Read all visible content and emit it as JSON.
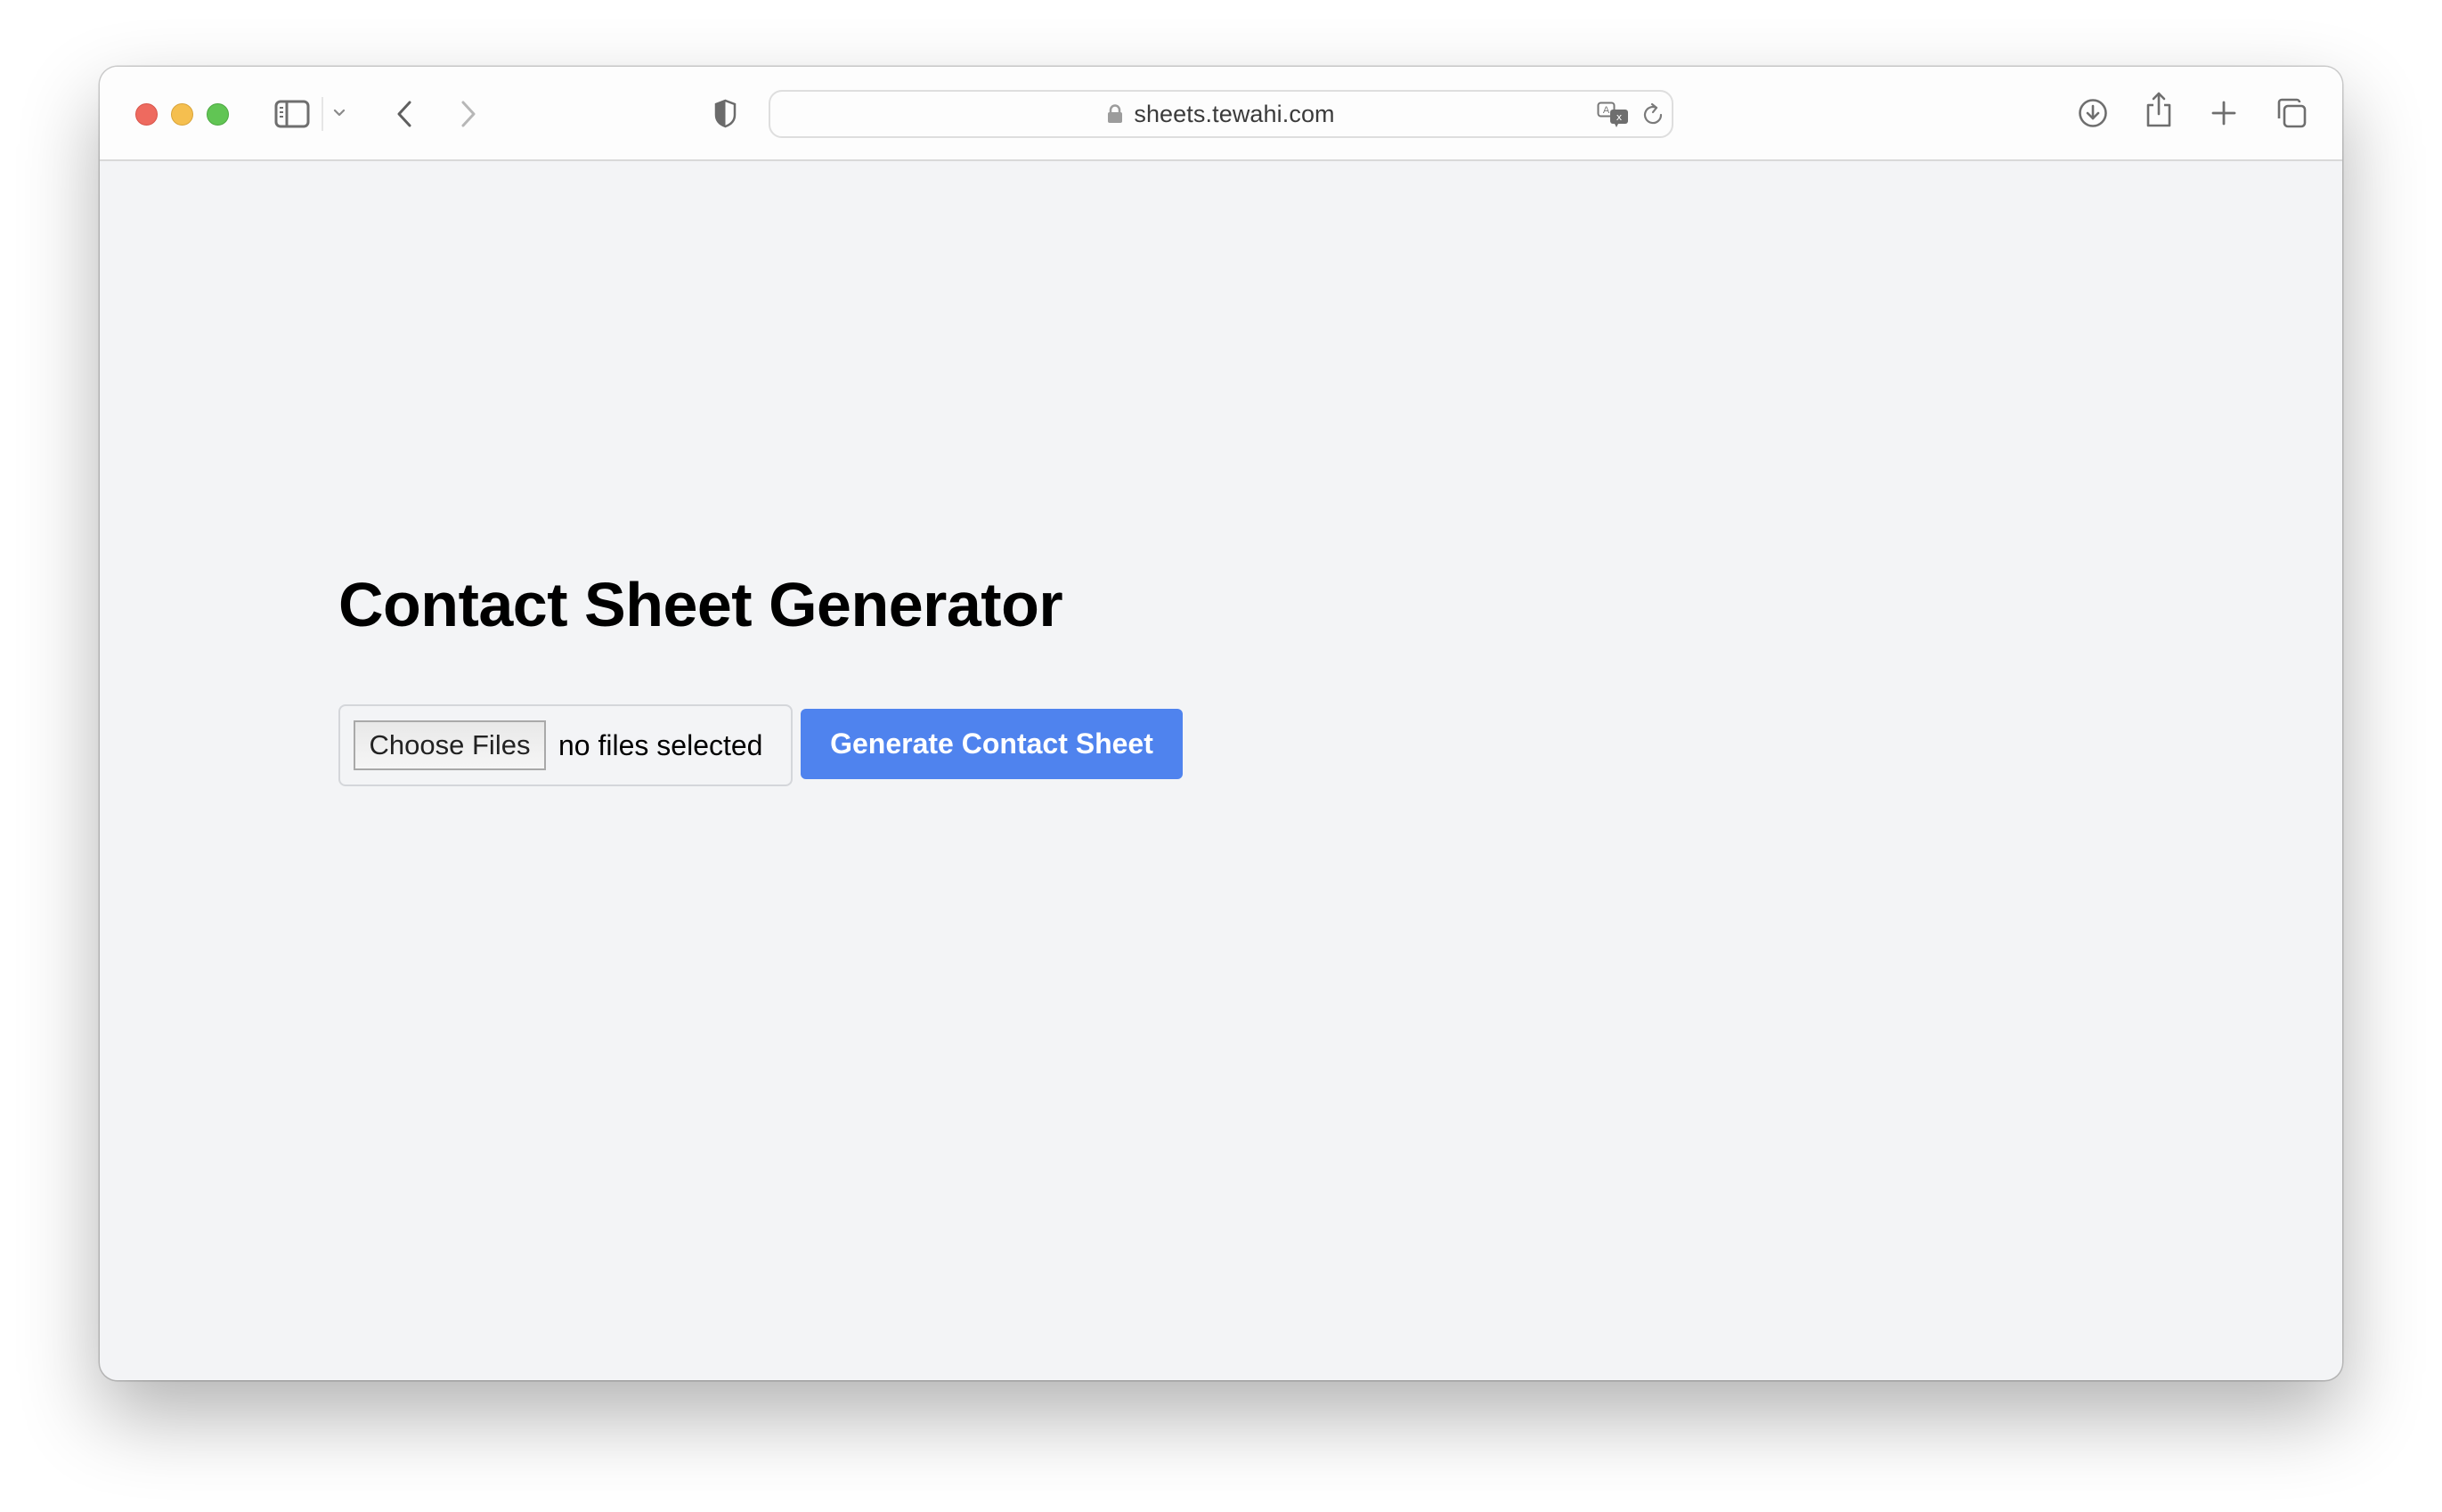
{
  "browser": {
    "url": "sheets.tewahi.com",
    "icons": {
      "sidebar": "sidebar-icon",
      "tab_group_menu": "chevron-down-icon",
      "back": "chevron-left-icon",
      "forward": "chevron-right-icon",
      "privacy": "shield-icon",
      "lock": "lock-icon",
      "translate": "translate-icon",
      "reload": "reload-icon",
      "downloads": "download-icon",
      "share": "share-icon",
      "new_tab": "plus-icon",
      "tab_overview": "tabs-icon"
    }
  },
  "page": {
    "title": "Contact Sheet Generator",
    "file_input": {
      "button_label": "Choose Files",
      "status": "no files selected"
    },
    "generate_button": {
      "label": "Generate Contact Sheet",
      "color": "#4f83ee"
    }
  }
}
